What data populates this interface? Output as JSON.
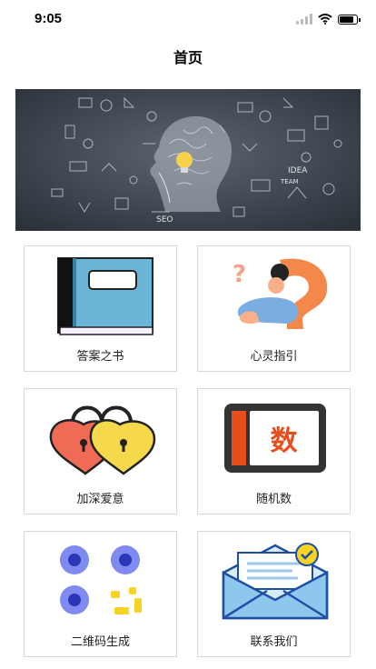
{
  "status_bar": {
    "time": "9:05",
    "battery_level": 0.9
  },
  "page": {
    "title": "首页"
  },
  "banner": {
    "image_name": "brain-ideas-banner",
    "doodle_texts": [
      "SEO",
      "IDEA",
      "TEAM"
    ]
  },
  "menu": [
    {
      "label": "答案之书",
      "icon": "book-icon",
      "colors": [
        "#6bb6d6",
        "#111111"
      ]
    },
    {
      "label": "心灵指引",
      "icon": "question-mark-person-icon",
      "colors": [
        "#f4884a",
        "#7aaee0"
      ]
    },
    {
      "label": "加深爱意",
      "icon": "heart-locks-icon",
      "colors": [
        "#f06b55",
        "#f5d94a"
      ]
    },
    {
      "label": "随机数",
      "icon": "number-card-icon",
      "badge_text": "数",
      "colors": [
        "#e84e1b",
        "#333333"
      ]
    },
    {
      "label": "二维码生成",
      "icon": "qr-dots-icon",
      "colors": [
        "#7f8bf0",
        "#f5d424"
      ]
    },
    {
      "label": "联系我们",
      "icon": "mail-envelope-icon",
      "colors": [
        "#8ec7ee",
        "#f5d424"
      ]
    }
  ]
}
